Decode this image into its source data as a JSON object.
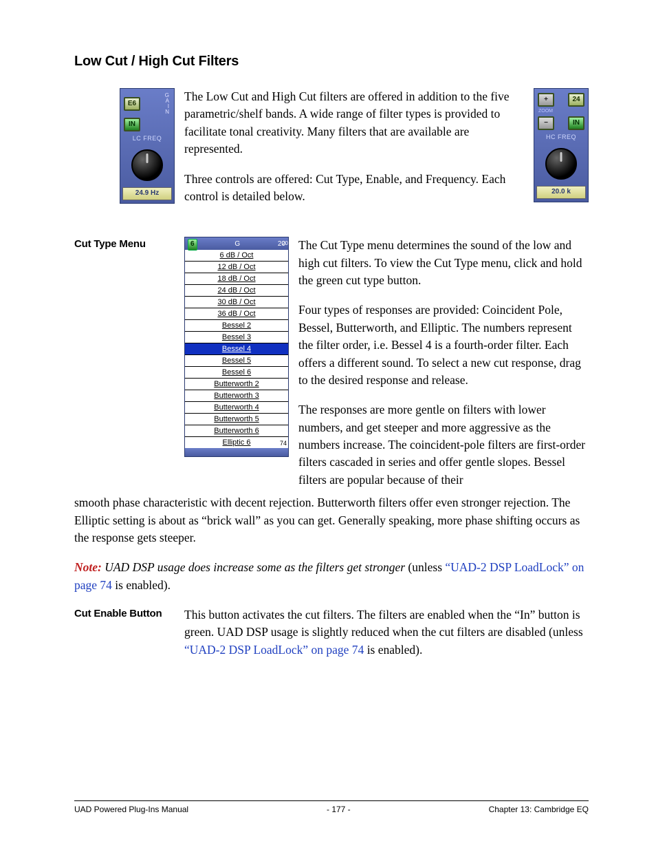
{
  "heading": "Low Cut / High Cut Filters",
  "plugin_lc": {
    "btn_type": "E6",
    "btn_in": "IN",
    "gain": "G\nA\nI\nN",
    "label": "LC FREQ",
    "value": "24.9 Hz"
  },
  "plugin_hc": {
    "btn_plus": "+",
    "btn_minus": "−",
    "btn_24": "24",
    "btn_in": "IN",
    "zoom": "ZOOM",
    "label": "HC FREQ",
    "value": "20.0 k"
  },
  "intro": {
    "p1": "The Low Cut and High Cut filters are offered in addition to the five parametric/shelf bands. A wide range of filter types is provided to facilitate tonal creativity. Many filters that are available are represented.",
    "p2": "Three controls are offered: Cut Type, Enable, and Frequency. Each control is detailed below."
  },
  "cuttype": {
    "title": "Cut Type Menu",
    "menu_header_6": "6",
    "menu_header_g": "G",
    "menu_header_20": "20",
    "menu_header_20s": "20",
    "items": [
      "6 dB / Oct",
      "12 dB / Oct",
      "18 dB / Oct",
      "24 dB / Oct",
      "30 dB / Oct",
      "36 dB / Oct",
      "Bessel 2",
      "Bessel 3",
      "Bessel 4",
      "Bessel 5",
      "Bessel 6",
      "Butterworth 2",
      "Butterworth 3",
      "Butterworth 4",
      "Butterworth 5",
      "Butterworth 6",
      "Elliptic 6"
    ],
    "selected_index": 8,
    "p1": "The Cut Type menu determines the sound of the low and high cut filters. To view the Cut Type menu, click and hold the green cut type button.",
    "p2": "Four types of responses are provided: Coincident Pole, Bessel, Butterworth, and Elliptic. The numbers represent the filter order, i.e. Bessel 4 is a fourth-order filter. Each offers a different sound. To select a new cut response, drag to the desired response and release.",
    "p3a": "The responses are more gentle on filters with lower numbers, and get steeper and more aggressive as the numbers increase. The coincident-pole filters are first-order filters cascaded in series and offer gentle slopes. Bessel filters are popular because of their",
    "p3b": "smooth phase characteristic with decent rejection. Butterworth filters offer even stronger rejection. The Elliptic setting is about as “brick wall” as you can get. Generally speaking, more phase shifting occurs as the response gets steeper.",
    "note_label": "Note:",
    "note_text_a": " UAD DSP usage does increase some as the filters get stronger ",
    "note_text_unless": "(unless ",
    "note_link": "“UAD-2 DSP LoadLock” on page 74",
    "note_text_b": " is enabled)."
  },
  "cutenable": {
    "title": "Cut Enable Button",
    "p_a": "This button activates the cut filters. The filters are enabled when the “In” button is green. UAD DSP usage is slightly reduced when the cut filters are disabled (unless ",
    "link": "“UAD-2 DSP LoadLock” on page 74",
    "p_b": " is enabled)."
  },
  "footer": {
    "left": "UAD Powered Plug-Ins Manual",
    "center": "- 177 -",
    "right": "Chapter 13: Cambridge EQ"
  }
}
